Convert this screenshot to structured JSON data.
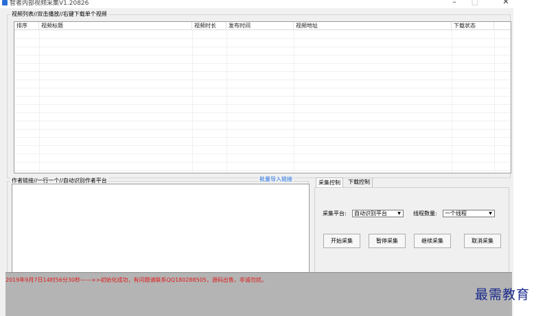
{
  "window": {
    "title": "智者内部视频采集V1.20826",
    "minimize_glyph": "–",
    "maximize_glyph": "□",
    "close_glyph": "✕"
  },
  "video_list": {
    "group_label": "视频列表//双击播放//右键下载单个视频",
    "columns": [
      "排序",
      "视频标题",
      "视频时长",
      "发布时间",
      "视频地址",
      "下载状态"
    ],
    "rows": []
  },
  "author_links": {
    "group_label": "作者链接//一行一个//自动识别作者平台",
    "batch_import_link": "批量导入链接",
    "value": ""
  },
  "tabs": {
    "collect_control": "采集控制",
    "download_control": "下载控制",
    "active": "采集控制"
  },
  "collect_control": {
    "platform_label": "采集平台:",
    "platform_value": "自动识别平台",
    "threads_label": "线程数量:",
    "threads_value": "一个线程",
    "dropdown_arrow": "▼",
    "buttons": {
      "start": "开始采集",
      "pause": "暂停采集",
      "resume": "继续采集",
      "cancel": "取消采集"
    }
  },
  "status": {
    "message": "2019年9月7日14时56分30秒——>>初始化成功，有问题请联系QQ180288505，源码出售，非诚勿扰。"
  },
  "watermark": {
    "text": "最需教育"
  },
  "colors": {
    "app_icon": "#2a6fd6",
    "link": "#1e6fe0",
    "status_text": "#e01818",
    "status_bg": "#b4b4b4",
    "window_bg": "#f0f0f0",
    "watermark": "#1a2a8c"
  }
}
